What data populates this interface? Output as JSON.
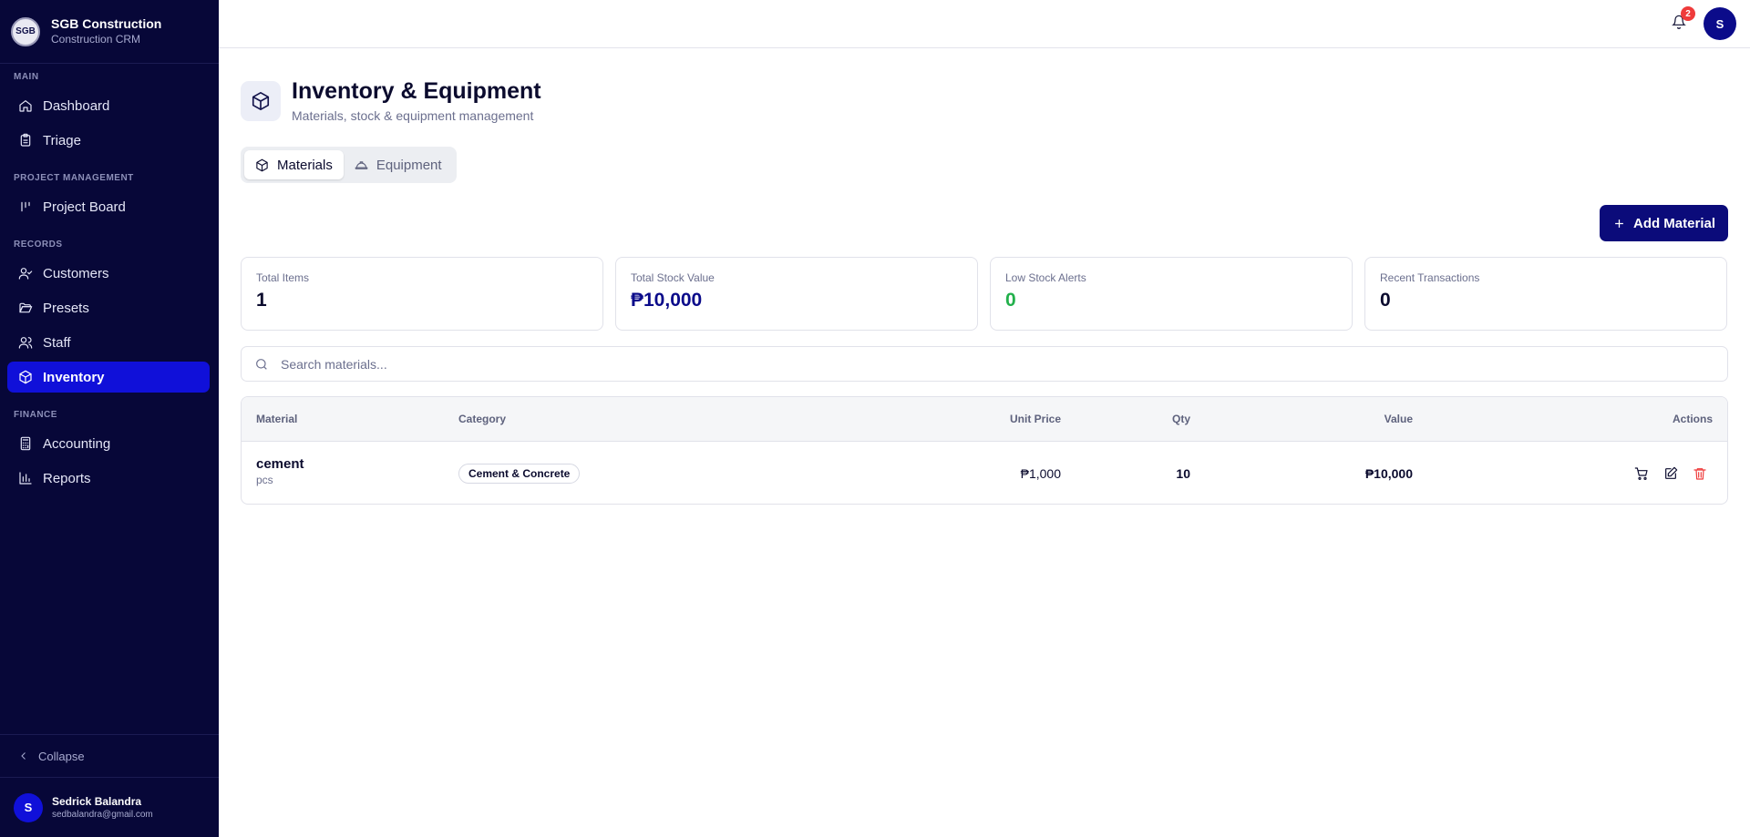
{
  "app": {
    "name": "SGB Construction",
    "subtitle": "Construction CRM",
    "logo_text": "SGB"
  },
  "sidebar": {
    "sections": [
      {
        "label": "MAIN"
      },
      {
        "label": "PROJECT MANAGEMENT"
      },
      {
        "label": "RECORDS"
      },
      {
        "label": "FINANCE"
      }
    ],
    "items": [
      {
        "label": "Dashboard",
        "icon": "home-icon"
      },
      {
        "label": "Triage",
        "icon": "clipboard-icon"
      },
      {
        "label": "Project Board",
        "icon": "kanban-icon"
      },
      {
        "label": "Customers",
        "icon": "user-check-icon"
      },
      {
        "label": "Presets",
        "icon": "folder-open-icon"
      },
      {
        "label": "Staff",
        "icon": "users-icon"
      },
      {
        "label": "Inventory",
        "icon": "package-icon",
        "active": true
      },
      {
        "label": "Accounting",
        "icon": "calculator-icon"
      },
      {
        "label": "Reports",
        "icon": "bar-chart-icon"
      }
    ],
    "collapse_label": "Collapse",
    "user": {
      "initial": "S",
      "name": "Sedrick Balandra",
      "email": "sedbalandra@gmail.com"
    }
  },
  "topbar": {
    "notification_count": "2",
    "avatar_initial": "S"
  },
  "header": {
    "title": "Inventory & Equipment",
    "subtitle": "Materials, stock & equipment management"
  },
  "tabs": [
    {
      "label": "Materials",
      "active": true
    },
    {
      "label": "Equipment",
      "active": false
    }
  ],
  "add_button_label": "Add Material",
  "stats": [
    {
      "label": "Total Items",
      "value": "1",
      "color": "#0b0b2e"
    },
    {
      "label": "Total Stock Value",
      "value": "₱10,000",
      "color": "#0b0b8a"
    },
    {
      "label": "Low Stock Alerts",
      "value": "0",
      "color": "#22b04b"
    },
    {
      "label": "Recent Transactions",
      "value": "0",
      "color": "#0b0b2e"
    }
  ],
  "search": {
    "placeholder": "Search materials..."
  },
  "table": {
    "columns": [
      "Material",
      "Category",
      "Unit Price",
      "Qty",
      "Value",
      "Actions"
    ],
    "rows": [
      {
        "material": "cement",
        "unit": "pcs",
        "category": "Cement & Concrete",
        "unit_price": "₱1,000",
        "qty": "10",
        "value": "₱10,000"
      }
    ]
  },
  "colors": {
    "sidebar_bg": "#070738",
    "accent": "#1010d9",
    "primary_button": "#0b0b7a",
    "danger": "#ef3b3b"
  }
}
